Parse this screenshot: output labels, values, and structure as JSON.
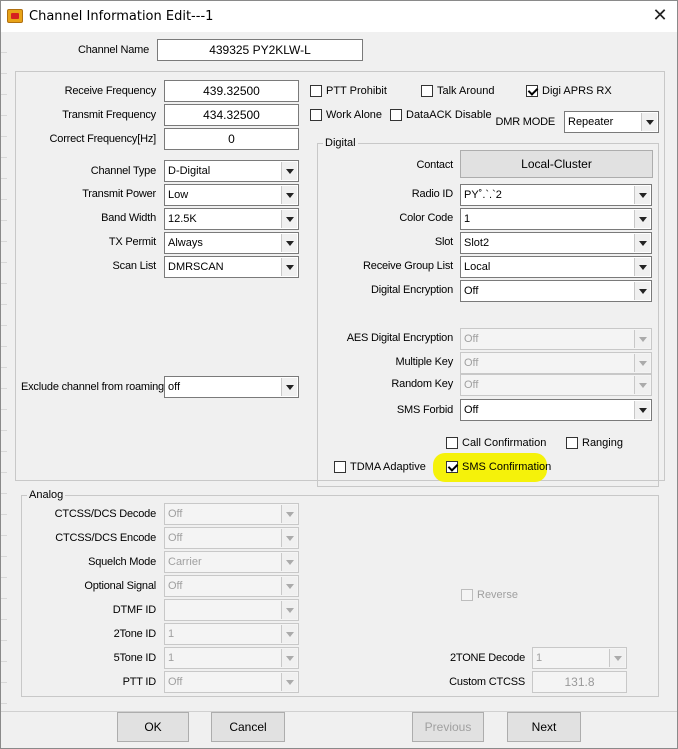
{
  "window": {
    "title": "Channel Information Edit---1",
    "close_glyph": "✕"
  },
  "channel_name": {
    "label": "Channel Name",
    "value": "439325 PY2KLW-L"
  },
  "basic": {
    "receive_frequency": {
      "label": "Receive Frequency",
      "value": "439.32500"
    },
    "transmit_frequency": {
      "label": "Transmit Frequency",
      "value": "434.32500"
    },
    "correct_frequency": {
      "label": "Correct Frequency[Hz]",
      "value": "0"
    },
    "channel_type": {
      "label": "Channel Type",
      "value": "D-Digital"
    },
    "transmit_power": {
      "label": "Transmit Power",
      "value": "Low"
    },
    "band_width": {
      "label": "Band Width",
      "value": "12.5K"
    },
    "tx_permit": {
      "label": "TX Permit",
      "value": "Always"
    },
    "scan_list": {
      "label": "Scan List",
      "value": "DMRSCAN"
    },
    "exclude_roaming": {
      "label": "Exclude channel from roaming",
      "value": "off"
    }
  },
  "checks": {
    "ptt_prohibit": {
      "label": "PTT Prohibit",
      "checked": false
    },
    "talk_around": {
      "label": "Talk Around",
      "checked": false
    },
    "digi_aprs_rx": {
      "label": "Digi APRS RX",
      "checked": true
    },
    "work_alone": {
      "label": "Work Alone",
      "checked": false
    },
    "dataack_disable": {
      "label": "DataACK Disable",
      "checked": false
    }
  },
  "dmr_mode": {
    "label": "DMR MODE",
    "value": "Repeater"
  },
  "digital": {
    "group_title": "Digital",
    "contact": {
      "label": "Contact",
      "button_label": "Local-Cluster"
    },
    "radio_id": {
      "label": "Radio ID",
      "value": "PY˚.`.`2"
    },
    "color_code": {
      "label": "Color Code",
      "value": "1"
    },
    "slot": {
      "label": "Slot",
      "value": "Slot2"
    },
    "receive_group_list": {
      "label": "Receive Group List",
      "value": "Local"
    },
    "digital_encryption": {
      "label": "Digital Encryption",
      "value": "Off"
    },
    "aes_encryption": {
      "label": "AES Digital Encryption",
      "value": "Off"
    },
    "multiple_key": {
      "label": "Multiple Key",
      "value": "Off"
    },
    "random_key": {
      "label": "Random Key",
      "value": "Off"
    },
    "sms_forbid": {
      "label": "SMS Forbid",
      "value": "Off"
    },
    "call_confirmation": {
      "label": "Call Confirmation",
      "checked": false
    },
    "ranging": {
      "label": "Ranging",
      "checked": false
    },
    "tdma_adaptive": {
      "label": "TDMA Adaptive",
      "checked": false
    },
    "sms_confirmation": {
      "label": "SMS Confirmation",
      "checked": true
    }
  },
  "analog": {
    "group_title": "Analog",
    "ctcss_decode": {
      "label": "CTCSS/DCS Decode",
      "value": "Off"
    },
    "ctcss_encode": {
      "label": "CTCSS/DCS Encode",
      "value": "Off"
    },
    "squelch_mode": {
      "label": "Squelch Mode",
      "value": "Carrier"
    },
    "optional_signal": {
      "label": "Optional Signal",
      "value": "Off"
    },
    "dtmf_id": {
      "label": "DTMF ID",
      "value": ""
    },
    "two_tone_id": {
      "label": "2Tone ID",
      "value": "1"
    },
    "five_tone_id": {
      "label": "5Tone ID",
      "value": "1"
    },
    "ptt_id": {
      "label": "PTT ID",
      "value": "Off"
    },
    "reverse": {
      "label": "Reverse",
      "checked": false
    },
    "two_tone_decode": {
      "label": "2TONE Decode",
      "value": "1"
    },
    "custom_ctcss": {
      "label": "Custom CTCSS",
      "value": "131.8"
    }
  },
  "buttons": {
    "ok": "OK",
    "cancel": "Cancel",
    "previous": "Previous",
    "next": "Next"
  },
  "colors": {
    "highlight": "#f5f20a",
    "window_bg": "#f0f0f0"
  }
}
